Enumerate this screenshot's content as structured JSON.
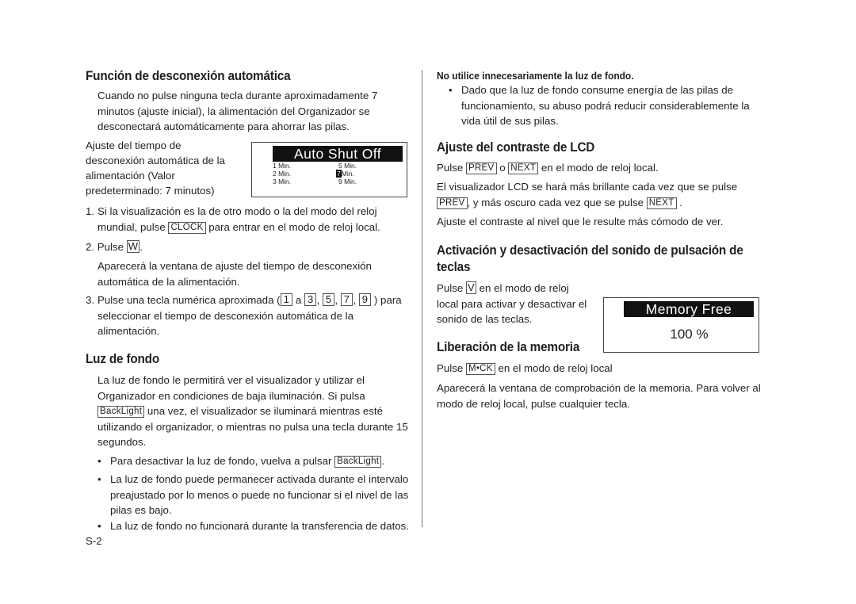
{
  "left": {
    "section1": {
      "title": "Función de desconexión automática",
      "intro": [
        "Cuando no pulse ninguna tecla durante aproximadamente 7",
        "minutos (ajuste inicial), la alimentación del Organizador se",
        "desconectará automáticamente para ahorrar las pilas."
      ],
      "caption": [
        "Ajuste del tiempo de",
        "desconexión automática de la",
        "alimentación (Valor",
        "predeterminado:  7 minutos)"
      ],
      "lcd": {
        "title": "Auto Shut Off",
        "options": [
          "1 Min.",
          "2 Min.",
          "3 Min.",
          "5 Min.",
          "7",
          "Min.",
          "9 Min."
        ],
        "selected_value": "7"
      },
      "step1": {
        "num": "1.",
        "line1": "Si la visualización es la de otro modo o la del modo del reloj",
        "line2_pre": "mundial, pulse ",
        "key": "CLOCK",
        "line2_post": " para entrar en el modo de reloj local."
      },
      "step2": {
        "num": "2.",
        "pre": "Pulse ",
        "key": "W",
        "post": ".",
        "desc": [
          "Aparecerá la ventana de ajuste del tiempo de desconexión",
          "automática de la alimentación."
        ]
      },
      "step3": {
        "num": "3.",
        "pre": "Pulse una tecla numérica aproximada (",
        "keys": [
          "1",
          "3",
          "5",
          "7",
          "9"
        ],
        "a": " a ",
        "comma": ",  ",
        "post": " ) para",
        "rest": [
          "seleccionar el tiempo de desconexión automática de la",
          "alimentación."
        ]
      }
    },
    "section2": {
      "title": "Luz de fondo",
      "p1": [
        "La luz de fondo le permitirá ver el visualizador y utilizar el",
        "Organizador en condiciones de baja iluminación.  Si pulsa"
      ],
      "key": "BackLight",
      "p1_after_key": " una vez, el visualizador se iluminará mientras esté",
      "p1_rest": [
        "utilizando el organizador, o mientras no pulsa una tecla durante 15",
        "segundos."
      ],
      "bullet_char": "•",
      "bullet1_pre": "Para desactivar la luz de fondo, vuelva a pulsar ",
      "bullet1_post": ".",
      "bullet2": [
        "La luz de fondo puede permanecer activada durante el intervalo",
        "preajustado por lo menos o puede no funcionar si el nivel de las",
        "pilas es bajo."
      ],
      "bullet3": "La luz de fondo no funcionará durante la transferencia de datos."
    },
    "page_number": "S-2"
  },
  "right": {
    "note": {
      "title": "No utilice innecesariamente la luz de fondo.",
      "bullet": [
        "Dado que la luz de fondo consume energía de las pilas de",
        "funcionamiento, su abuso podrá reducir considerablemente la",
        "vida útil de sus pilas."
      ]
    },
    "contrast": {
      "title": "Ajuste del contraste de LCD",
      "l1_pre": "Pulse ",
      "key_prev": "PREV",
      "l1_mid": " o ",
      "key_next": "NEXT",
      "l1_post": " en el modo de reloj local.",
      "l2": "El visualizador LCD se hará más brillante cada vez que se pulse",
      "l3_mid": ", y más oscuro cada vez que se pulse ",
      "l3_post": " .",
      "l4": "Ajuste el contraste al nivel que le resulte más cómodo de ver."
    },
    "keysound": {
      "title_line1": "Activación y desactivación del sonido de pulsación de",
      "title_line2": "teclas",
      "l1_pre": "Pulse ",
      "key": "V",
      "l1_post": " en el modo de reloj",
      "rest": [
        "local para activar y desactivar el",
        "sonido de las teclas."
      ]
    },
    "memory": {
      "title": "Liberación de la memoria",
      "lcd": {
        "title": "Memory Free",
        "value": "100 %"
      },
      "l1_pre": "Pulse ",
      "key": "M•CK",
      "l1_post": " en el modo de reloj local",
      "desc": [
        "Aparecerá la ventana de comprobación de la memoria.  Para volver al",
        "modo de reloj local, pulse cualquier tecla."
      ]
    }
  }
}
